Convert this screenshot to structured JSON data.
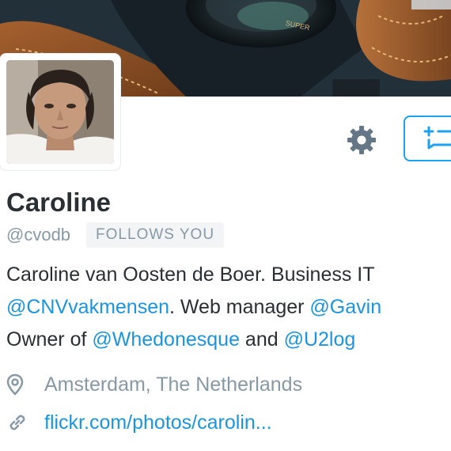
{
  "profile": {
    "name": "Caroline",
    "handle": "@cvodb",
    "follows_badge": "FOLLOWS YOU",
    "bio": {
      "line1_text": "Caroline van Oosten de Boer. Business IT",
      "line2_mention1": "@CNVvakmensen",
      "line2_text": ". Web manager ",
      "line2_mention2": "@Gavin",
      "line3_text1": "Owner of ",
      "line3_mention1": "@Whedonesque",
      "line3_text2": " and ",
      "line3_mention2": "@U2log"
    },
    "location": "Amsterdam, The Netherlands",
    "url": "flickr.com/photos/carolin..."
  },
  "banner": {
    "lens_text": "SUPER"
  },
  "icons": {
    "settings": "gear-icon",
    "message": "message-add-icon",
    "location": "map-pin-icon",
    "link": "link-icon"
  },
  "colors": {
    "accent": "#1da1f2",
    "link": "#1b95e0",
    "muted": "#8899a6",
    "text": "#292f33",
    "icon_gray": "#657786"
  }
}
